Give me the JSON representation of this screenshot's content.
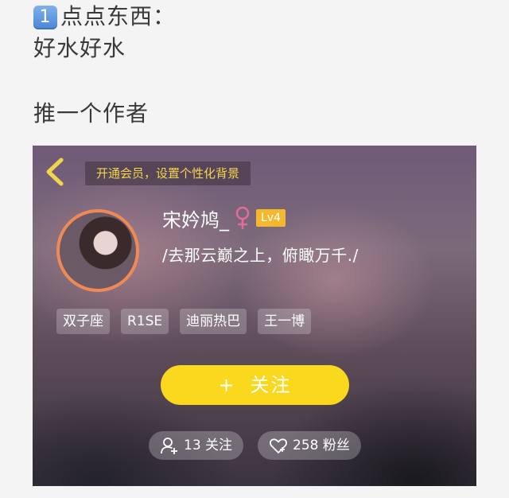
{
  "post": {
    "line1_badge": "1",
    "line1_text": "点点东西：",
    "line2_text": "好水好水",
    "line3_text": "推一个作者"
  },
  "profile_card": {
    "vip_banner": "开通会员，设置个性化背景",
    "username": "宋妗鸠_",
    "gender_symbol": "♀",
    "level": "Lv4",
    "signature": "/去那云巅之上，俯瞰万千./",
    "tags": [
      "双子座",
      "R1SE",
      "迪丽热巴",
      "王一博"
    ],
    "follow_button": {
      "plus": "+",
      "label": "关注"
    },
    "following": "13 关注",
    "fans": "258 粉丝",
    "colors": {
      "accent_yellow": "#fad81d",
      "banner_text": "#f3d54a",
      "level_badge": "#f5b72b",
      "avatar_border": "#f08a55",
      "gender_pink": "#e86a9a"
    }
  }
}
